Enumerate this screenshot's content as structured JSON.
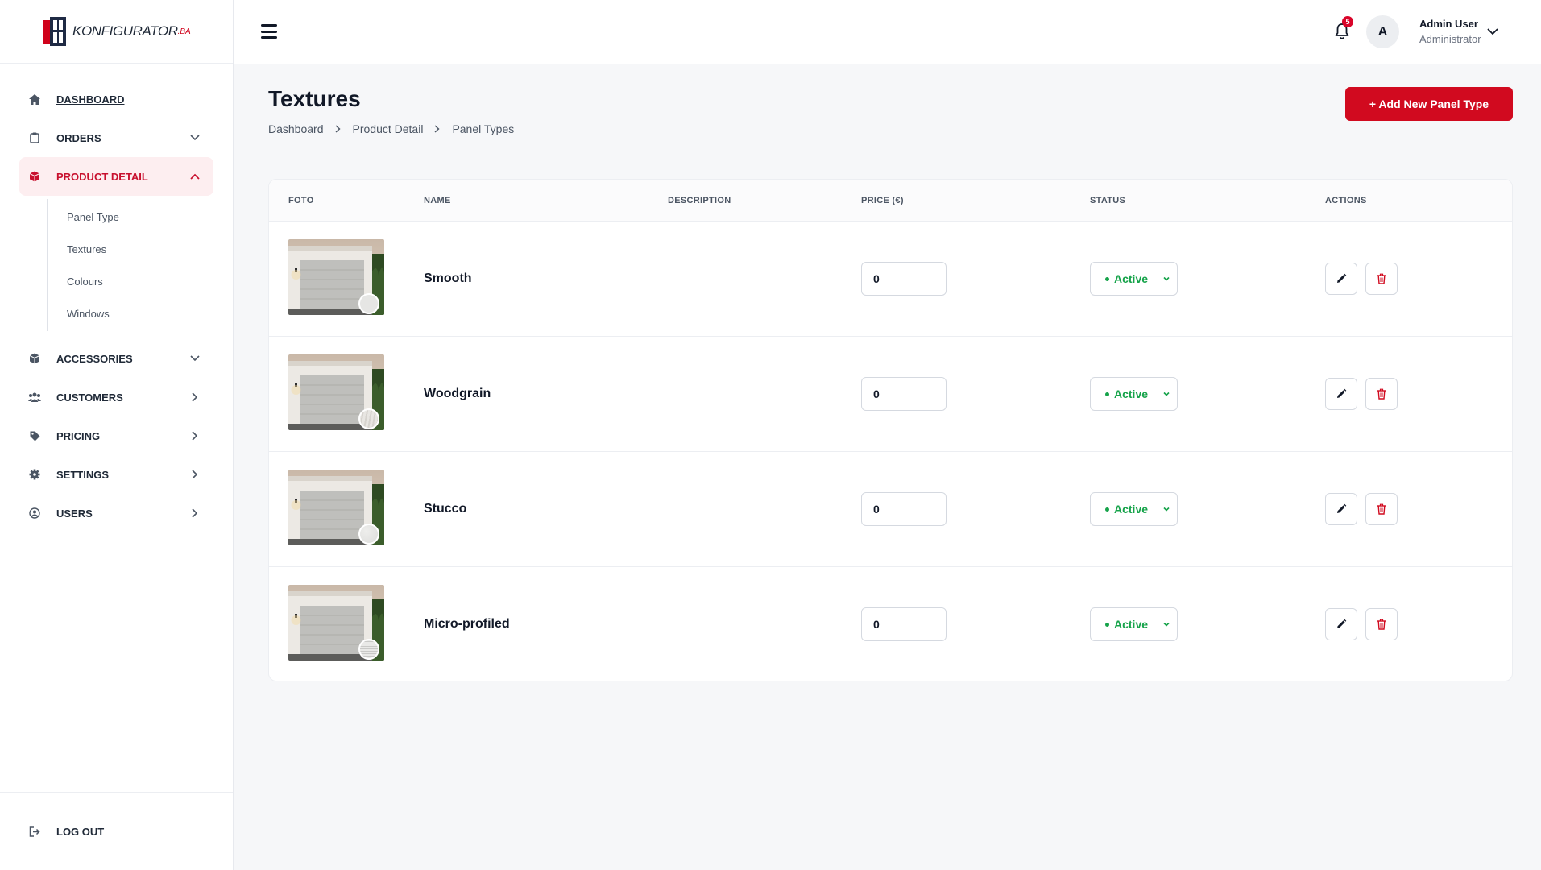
{
  "brand": {
    "name": "KONFIGURATOR",
    "tld": ".BA"
  },
  "sidebar": {
    "items": [
      {
        "label": "DASHBOARD",
        "icon": "home-icon"
      },
      {
        "label": "ORDERS",
        "icon": "clipboard-icon"
      },
      {
        "label": "PRODUCT DETAIL",
        "icon": "box-icon"
      },
      {
        "label": "ACCESSORIES",
        "icon": "cube-icon"
      },
      {
        "label": "CUSTOMERS",
        "icon": "users-icon"
      },
      {
        "label": "PRICING",
        "icon": "tag-icon"
      },
      {
        "label": "SETTINGS",
        "icon": "gear-icon"
      },
      {
        "label": "USERS",
        "icon": "user-circle-icon"
      }
    ],
    "sub_items": [
      "Panel Type",
      "Textures",
      "Colours",
      "Windows"
    ],
    "logout": "LOG OUT"
  },
  "topbar": {
    "notifications": "5",
    "avatar_initial": "A",
    "user_name": "Admin User",
    "user_role": "Administrator"
  },
  "page": {
    "title": "Textures",
    "breadcrumb": [
      "Dashboard",
      "Product Detail",
      "Panel Types"
    ],
    "add_button": "+ Add New Panel Type"
  },
  "table": {
    "columns": [
      "FOTO",
      "NAME",
      "DESCRIPTION",
      "PRICE (€)",
      "STATUS",
      "ACTIONS"
    ],
    "rows": [
      {
        "name": "Smooth",
        "description": "",
        "price": "0",
        "status": "Active",
        "texture": "smooth"
      },
      {
        "name": "Woodgrain",
        "description": "",
        "price": "0",
        "status": "Active",
        "texture": "wood"
      },
      {
        "name": "Stucco",
        "description": "",
        "price": "0",
        "status": "Active",
        "texture": "stucco"
      },
      {
        "name": "Micro-profiled",
        "description": "",
        "price": "0",
        "status": "Active",
        "texture": "micro"
      }
    ]
  },
  "colors": {
    "accent": "#d10a1f",
    "active_bg": "#fdeef0",
    "status_green": "#16a34a"
  }
}
